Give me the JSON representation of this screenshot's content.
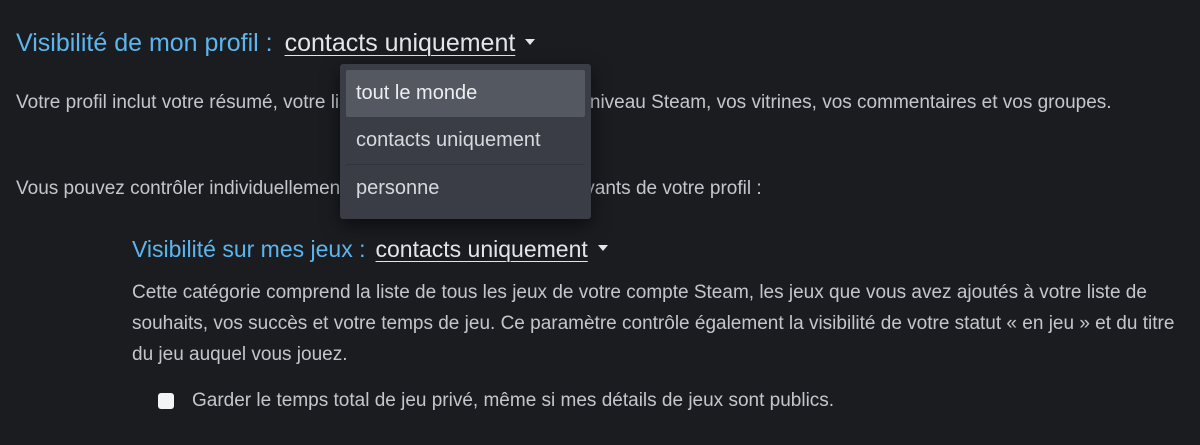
{
  "profile_visibility": {
    "label": "Visibilité de mon profil :",
    "value": "contacts uniquement",
    "description": "Votre profil inclut votre résumé, votre liste d'amis, vos badges, votre niveau Steam, vos vitrines, vos commentaires et vos groupes.",
    "control_text": "Vous pouvez contrôler individuellement la visibilité des éléments suivants de votre profil :"
  },
  "dropdown_menu": {
    "options": [
      "tout le monde",
      "contacts uniquement",
      "personne"
    ],
    "highlighted_index": 0
  },
  "game_visibility": {
    "label": "Visibilité sur mes jeux :",
    "value": "contacts uniquement",
    "description": "Cette catégorie comprend la liste de tous les jeux de votre compte Steam, les jeux que vous avez ajoutés à votre liste de souhaits, vos succès et votre temps de jeu. Ce paramètre contrôle également la visibilité de votre statut « en jeu » et du titre du jeu auquel vous jouez."
  },
  "playtime_checkbox": {
    "label": "Garder le temps total de jeu privé, même si mes détails de jeux sont publics.",
    "checked": false
  },
  "colors": {
    "background": "#1b1c20",
    "accent_label": "#5bb5ee",
    "text": "#c3c7cc",
    "menu_background": "#3a3d45",
    "menu_highlight": "#545861"
  }
}
